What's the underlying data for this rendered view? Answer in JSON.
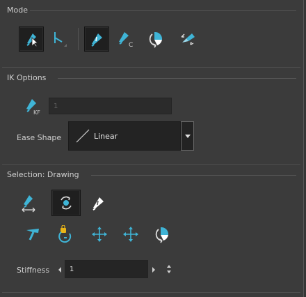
{
  "colors": {
    "accent_blue": "#3fb4d6",
    "panel_bg": "#3b3b3b",
    "selected_bg": "#1f1f1f"
  },
  "mode": {
    "title": "Mode",
    "tools": [
      {
        "icon": "transform-select-icon",
        "selected": true
      },
      {
        "icon": "bone-chain-icon",
        "selected": false
      },
      {
        "icon": "pen-transform-icon",
        "selected": true
      },
      {
        "icon": "pen-c-icon",
        "selected": false
      },
      {
        "icon": "rotate-pie-icon",
        "selected": false
      },
      {
        "icon": "pen-flip-icon",
        "selected": false
      }
    ]
  },
  "ik_options": {
    "title": "IK Options",
    "kf_value": "1",
    "ease_shape_label": "Ease Shape",
    "ease_shape_value": "Linear"
  },
  "selection": {
    "title": "Selection: Drawing",
    "row1": [
      {
        "icon": "pen-arrows-icon",
        "selected": false
      },
      {
        "icon": "rotate-circle-icon",
        "selected": true
      },
      {
        "icon": "pen-white-icon",
        "selected": false
      }
    ],
    "row2": [
      {
        "icon": "hammer-pin-icon"
      },
      {
        "icon": "lock-rotate-icon"
      },
      {
        "icon": "move-cross-icon"
      },
      {
        "icon": "move-cross-alt-icon"
      },
      {
        "icon": "rotate-pie-icon"
      }
    ],
    "stiffness_label": "Stiffness",
    "stiffness_value": "1"
  }
}
